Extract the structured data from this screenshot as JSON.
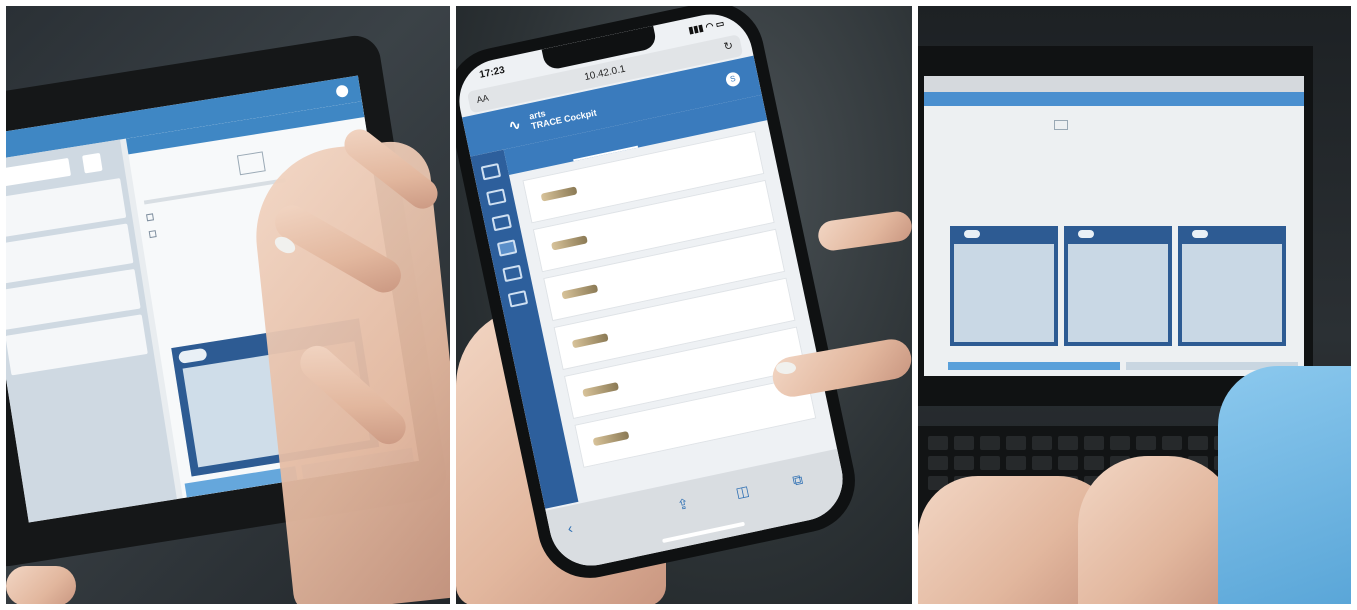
{
  "panels": {
    "tablet": {
      "header_user": "",
      "form_title": "",
      "checkbox_1": "",
      "checkbox_2": ""
    },
    "phone": {
      "status_time": "17:23",
      "status_icons": "▮▮▮ ◠ ▭",
      "url_aa": "AA",
      "url_domain": "10.42.0.1",
      "reload_icon": "↻",
      "logo_mark": "∿",
      "logo_line1": "arts",
      "logo_line2": "TRACE Cockpit",
      "user_initial": "S",
      "user_name": "",
      "tabs": [
        "",
        "",
        "",
        ""
      ],
      "items": [
        {
          "note": "",
          "label": ""
        },
        {
          "note": "",
          "label": ""
        },
        {
          "note": "",
          "label": ""
        },
        {
          "note": "",
          "label": ""
        },
        {
          "note": "",
          "label": ""
        },
        {
          "note": "",
          "label": ""
        },
        {
          "note": "",
          "label": ""
        }
      ],
      "bottom_icons": [
        "‹",
        "⇪",
        "◫",
        "⧉"
      ]
    },
    "laptop": {
      "user_label": "",
      "page_title": "",
      "page_subtitle": ""
    }
  },
  "colors": {
    "app_blue": "#3a7bbd",
    "app_dark_blue": "#2d5b93",
    "app_light_blue": "#65a7dc",
    "trackpoint_red": "#d0202a"
  }
}
